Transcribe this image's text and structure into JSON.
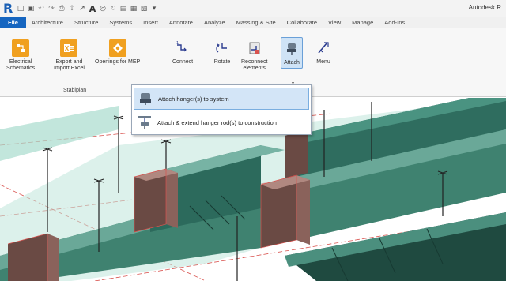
{
  "app": {
    "title": "Autodesk R"
  },
  "quick_access": [
    {
      "name": "logo-icon",
      "glyph": "R"
    },
    {
      "name": "open-icon",
      "glyph": "□"
    },
    {
      "name": "save-icon",
      "glyph": "▣"
    },
    {
      "name": "undo-icon",
      "glyph": "↶"
    },
    {
      "name": "redo-icon",
      "glyph": "↷"
    },
    {
      "name": "print-icon",
      "glyph": "⎙"
    },
    {
      "name": "measure-icon",
      "glyph": "↕"
    },
    {
      "name": "dimension-icon",
      "glyph": "↗"
    },
    {
      "name": "text-icon",
      "glyph": "A"
    },
    {
      "name": "view-icon",
      "glyph": "◎"
    },
    {
      "name": "sync-icon",
      "glyph": "↻"
    },
    {
      "name": "section-icon",
      "glyph": "▤"
    },
    {
      "name": "close-windows-icon",
      "glyph": "▦"
    },
    {
      "name": "switch-windows-icon",
      "glyph": "▧"
    },
    {
      "name": "customize-icon",
      "glyph": "▾"
    }
  ],
  "tabs": [
    "File",
    "Architecture",
    "Structure",
    "Systems",
    "Insert",
    "Annotate",
    "Analyze",
    "Massing & Site",
    "Collaborate",
    "View",
    "Manage",
    "Add-Ins"
  ],
  "ribbon": {
    "buttons": {
      "electrical": "Electrical\nSchematics",
      "export": "Export and\nImport Excel",
      "openings": "Openings for MEP",
      "connect": "Connect",
      "rotate": "Rotate",
      "reconnect": "Reconnect\nelements",
      "attach": "Attach",
      "menu": "Menu"
    },
    "panel_label": "Stabiplan"
  },
  "dropdown": {
    "items": [
      "Attach hanger(s) to system",
      "Attach & extend hanger rod(s) to construction"
    ]
  },
  "colors": {
    "file_tab": "#1565c0",
    "accent_orange": "#f0a020",
    "highlight": "#d3e5f7",
    "duct_teal": "#2f7a6a",
    "duct_glass": "#a8dccd",
    "border_red": "#d9534f"
  }
}
